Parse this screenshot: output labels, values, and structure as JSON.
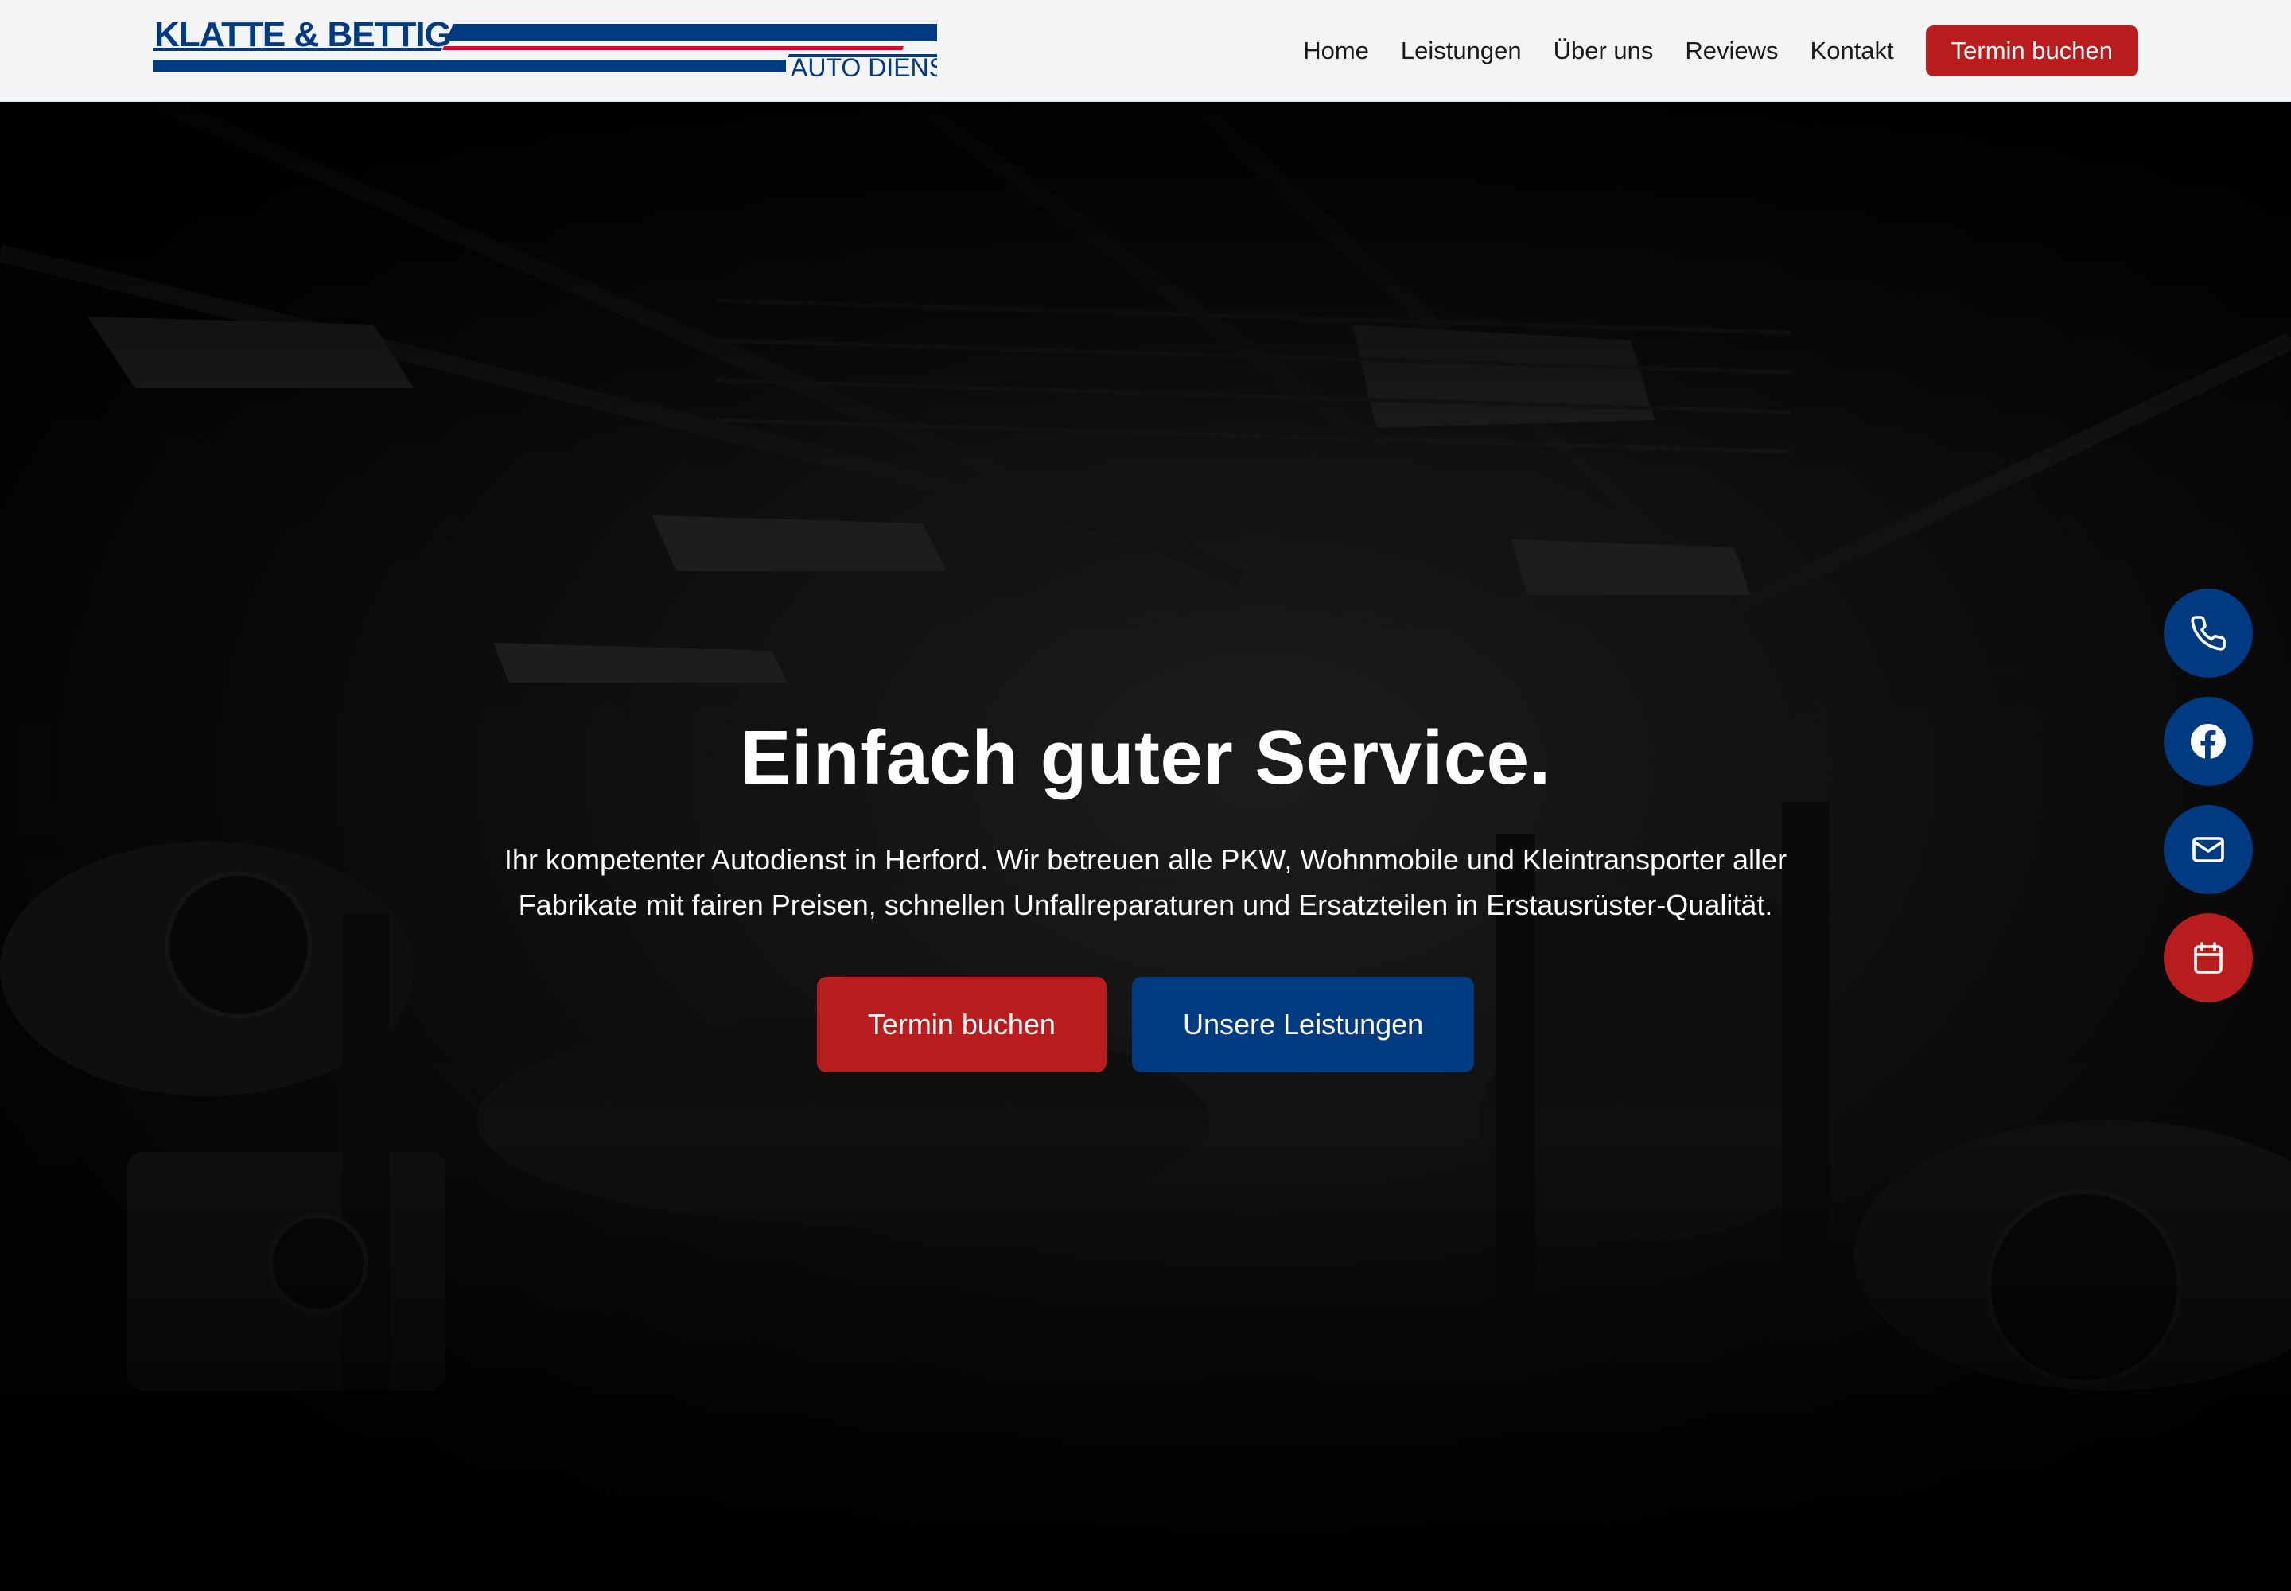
{
  "brand": {
    "name": "KLATTE & BETTIG",
    "tagline": "AUTO DIENST",
    "colors": {
      "navy": "#003a80",
      "red": "#b91c1c",
      "header_bg": "#f3f4f6"
    }
  },
  "nav": {
    "items": [
      {
        "label": "Home"
      },
      {
        "label": "Leistungen"
      },
      {
        "label": "Über uns"
      },
      {
        "label": "Reviews"
      },
      {
        "label": "Kontakt"
      }
    ],
    "cta_label": "Termin buchen"
  },
  "hero": {
    "title": "Einfach guter Service.",
    "subtitle": "Ihr kompetenter Autodienst in Herford. Wir betreuen alle PKW, Wohnmobile und Kleintransporter aller Fabrikate mit fairen Preisen, schnellen Unfallreparaturen und Ersatzteilen in Erstausrüster-Qualität.",
    "primary_button": "Termin buchen",
    "secondary_button": "Unsere Leistungen"
  },
  "floating_actions": [
    {
      "icon": "phone-icon",
      "color": "#003a80"
    },
    {
      "icon": "facebook-icon",
      "color": "#003a80"
    },
    {
      "icon": "mail-icon",
      "color": "#003a80"
    },
    {
      "icon": "calendar-icon",
      "color": "#b91c1c"
    }
  ]
}
